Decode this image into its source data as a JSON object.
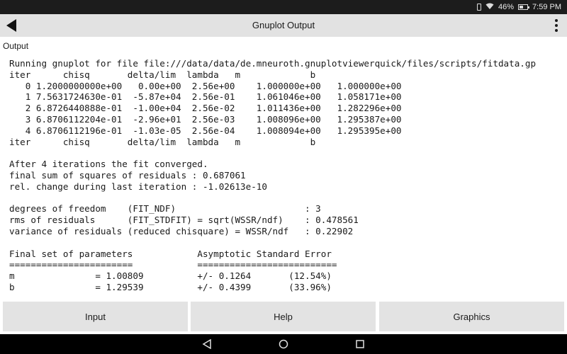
{
  "status_bar": {
    "battery_percent": "46%",
    "time": "7:59 PM",
    "battery_level": 0.46
  },
  "app_bar": {
    "title": "Gnuplot Output"
  },
  "section_label": "Output",
  "output_lines": [
    "Running gnuplot for file file:///data/data/de.mneuroth.gnuplotviewerquick/files/scripts/fitdata.gp",
    "iter      chisq       delta/lim  lambda   m             b",
    "   0 1.2000000000e+00   0.00e+00  2.56e+00    1.000000e+00   1.000000e+00",
    "   1 7.5631724630e-01  -5.87e+04  2.56e-01    1.061046e+00   1.058171e+00",
    "   2 6.8726440888e-01  -1.00e+04  2.56e-02    1.011436e+00   1.282296e+00",
    "   3 6.8706112204e-01  -2.96e+01  2.56e-03    1.008096e+00   1.295387e+00",
    "   4 6.8706112196e-01  -1.03e-05  2.56e-04    1.008094e+00   1.295395e+00",
    "iter      chisq       delta/lim  lambda   m             b",
    "",
    "After 4 iterations the fit converged.",
    "final sum of squares of residuals : 0.687061",
    "rel. change during last iteration : -1.02613e-10",
    "",
    "degrees of freedom    (FIT_NDF)                        : 3",
    "rms of residuals      (FIT_STDFIT) = sqrt(WSSR/ndf)    : 0.478561",
    "variance of residuals (reduced chisquare) = WSSR/ndf   : 0.22902",
    "",
    "Final set of parameters            Asymptotic Standard Error",
    "=======================            ==========================",
    "m               = 1.00809          +/- 0.1264       (12.54%)",
    "b               = 1.29539          +/- 0.4399       (33.96%)"
  ],
  "buttons": {
    "input": "Input",
    "help": "Help",
    "graphics": "Graphics"
  },
  "icons": {
    "back": "back-arrow-icon",
    "menu": "more-vert-icon",
    "nav_back": "triangle-back-icon",
    "nav_home": "circle-home-icon",
    "nav_recents": "square-recents-icon"
  }
}
